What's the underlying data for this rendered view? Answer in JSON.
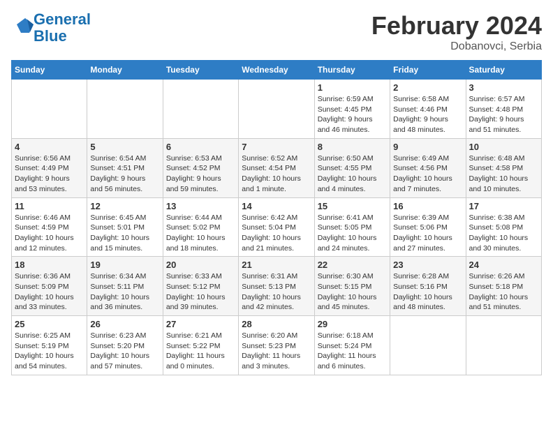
{
  "header": {
    "logo_line1": "General",
    "logo_line2": "Blue",
    "month_year": "February 2024",
    "location": "Dobanovci, Serbia"
  },
  "weekdays": [
    "Sunday",
    "Monday",
    "Tuesday",
    "Wednesday",
    "Thursday",
    "Friday",
    "Saturday"
  ],
  "weeks": [
    [
      {
        "day": "",
        "info": ""
      },
      {
        "day": "",
        "info": ""
      },
      {
        "day": "",
        "info": ""
      },
      {
        "day": "",
        "info": ""
      },
      {
        "day": "1",
        "info": "Sunrise: 6:59 AM\nSunset: 4:45 PM\nDaylight: 9 hours\nand 46 minutes."
      },
      {
        "day": "2",
        "info": "Sunrise: 6:58 AM\nSunset: 4:46 PM\nDaylight: 9 hours\nand 48 minutes."
      },
      {
        "day": "3",
        "info": "Sunrise: 6:57 AM\nSunset: 4:48 PM\nDaylight: 9 hours\nand 51 minutes."
      }
    ],
    [
      {
        "day": "4",
        "info": "Sunrise: 6:56 AM\nSunset: 4:49 PM\nDaylight: 9 hours\nand 53 minutes."
      },
      {
        "day": "5",
        "info": "Sunrise: 6:54 AM\nSunset: 4:51 PM\nDaylight: 9 hours\nand 56 minutes."
      },
      {
        "day": "6",
        "info": "Sunrise: 6:53 AM\nSunset: 4:52 PM\nDaylight: 9 hours\nand 59 minutes."
      },
      {
        "day": "7",
        "info": "Sunrise: 6:52 AM\nSunset: 4:54 PM\nDaylight: 10 hours\nand 1 minute."
      },
      {
        "day": "8",
        "info": "Sunrise: 6:50 AM\nSunset: 4:55 PM\nDaylight: 10 hours\nand 4 minutes."
      },
      {
        "day": "9",
        "info": "Sunrise: 6:49 AM\nSunset: 4:56 PM\nDaylight: 10 hours\nand 7 minutes."
      },
      {
        "day": "10",
        "info": "Sunrise: 6:48 AM\nSunset: 4:58 PM\nDaylight: 10 hours\nand 10 minutes."
      }
    ],
    [
      {
        "day": "11",
        "info": "Sunrise: 6:46 AM\nSunset: 4:59 PM\nDaylight: 10 hours\nand 12 minutes."
      },
      {
        "day": "12",
        "info": "Sunrise: 6:45 AM\nSunset: 5:01 PM\nDaylight: 10 hours\nand 15 minutes."
      },
      {
        "day": "13",
        "info": "Sunrise: 6:44 AM\nSunset: 5:02 PM\nDaylight: 10 hours\nand 18 minutes."
      },
      {
        "day": "14",
        "info": "Sunrise: 6:42 AM\nSunset: 5:04 PM\nDaylight: 10 hours\nand 21 minutes."
      },
      {
        "day": "15",
        "info": "Sunrise: 6:41 AM\nSunset: 5:05 PM\nDaylight: 10 hours\nand 24 minutes."
      },
      {
        "day": "16",
        "info": "Sunrise: 6:39 AM\nSunset: 5:06 PM\nDaylight: 10 hours\nand 27 minutes."
      },
      {
        "day": "17",
        "info": "Sunrise: 6:38 AM\nSunset: 5:08 PM\nDaylight: 10 hours\nand 30 minutes."
      }
    ],
    [
      {
        "day": "18",
        "info": "Sunrise: 6:36 AM\nSunset: 5:09 PM\nDaylight: 10 hours\nand 33 minutes."
      },
      {
        "day": "19",
        "info": "Sunrise: 6:34 AM\nSunset: 5:11 PM\nDaylight: 10 hours\nand 36 minutes."
      },
      {
        "day": "20",
        "info": "Sunrise: 6:33 AM\nSunset: 5:12 PM\nDaylight: 10 hours\nand 39 minutes."
      },
      {
        "day": "21",
        "info": "Sunrise: 6:31 AM\nSunset: 5:13 PM\nDaylight: 10 hours\nand 42 minutes."
      },
      {
        "day": "22",
        "info": "Sunrise: 6:30 AM\nSunset: 5:15 PM\nDaylight: 10 hours\nand 45 minutes."
      },
      {
        "day": "23",
        "info": "Sunrise: 6:28 AM\nSunset: 5:16 PM\nDaylight: 10 hours\nand 48 minutes."
      },
      {
        "day": "24",
        "info": "Sunrise: 6:26 AM\nSunset: 5:18 PM\nDaylight: 10 hours\nand 51 minutes."
      }
    ],
    [
      {
        "day": "25",
        "info": "Sunrise: 6:25 AM\nSunset: 5:19 PM\nDaylight: 10 hours\nand 54 minutes."
      },
      {
        "day": "26",
        "info": "Sunrise: 6:23 AM\nSunset: 5:20 PM\nDaylight: 10 hours\nand 57 minutes."
      },
      {
        "day": "27",
        "info": "Sunrise: 6:21 AM\nSunset: 5:22 PM\nDaylight: 11 hours\nand 0 minutes."
      },
      {
        "day": "28",
        "info": "Sunrise: 6:20 AM\nSunset: 5:23 PM\nDaylight: 11 hours\nand 3 minutes."
      },
      {
        "day": "29",
        "info": "Sunrise: 6:18 AM\nSunset: 5:24 PM\nDaylight: 11 hours\nand 6 minutes."
      },
      {
        "day": "",
        "info": ""
      },
      {
        "day": "",
        "info": ""
      }
    ]
  ]
}
